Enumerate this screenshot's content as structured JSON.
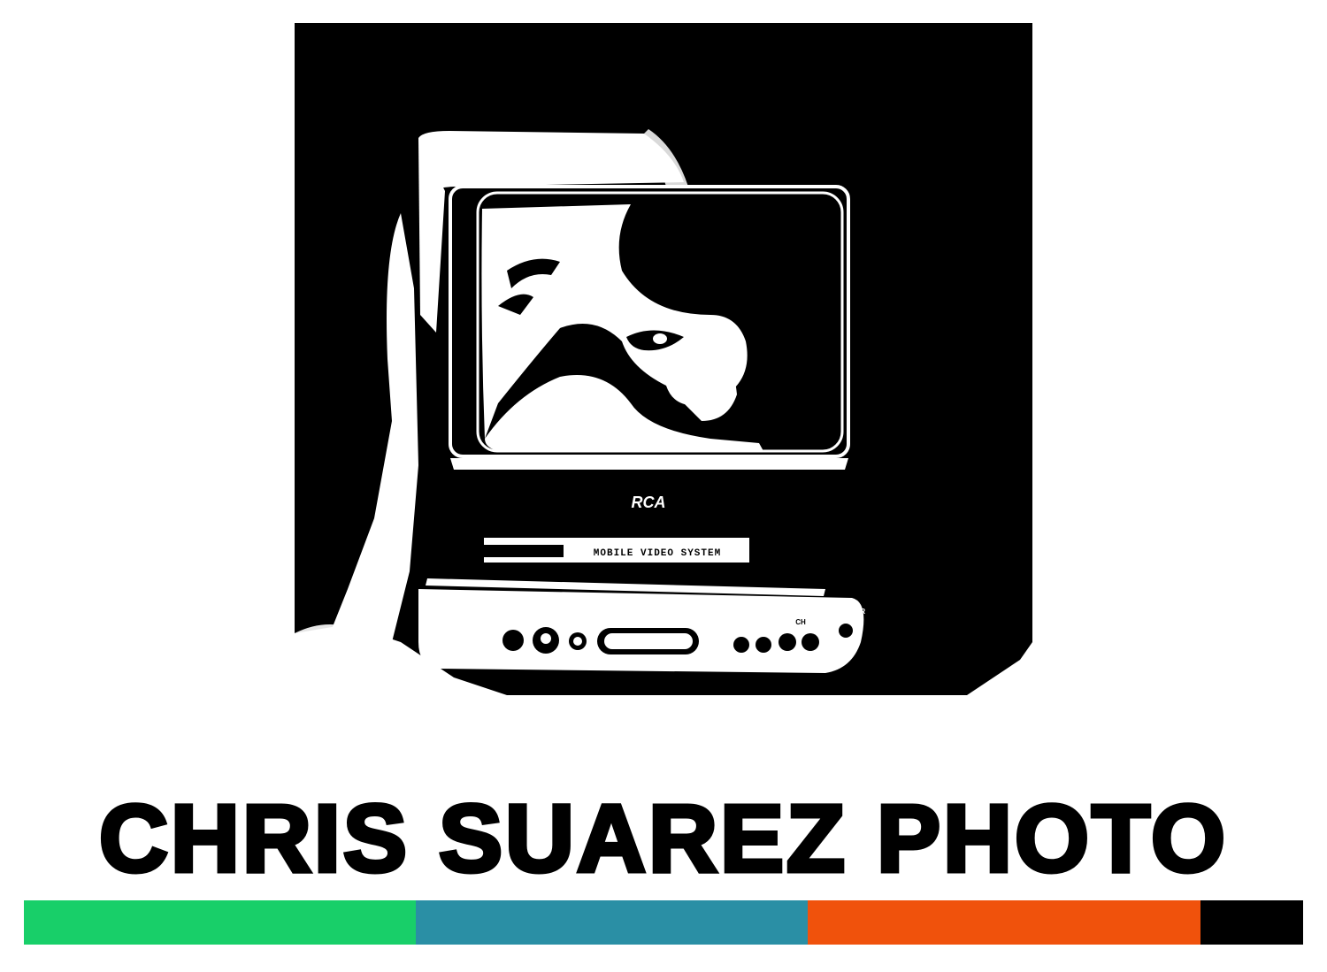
{
  "brand": {
    "title": "CHRIS SUAREZ PHOTO"
  },
  "photo": {
    "subject": "high-contrast black and white photo of a portable television",
    "tv_brand_label": "RCA",
    "tv_slot_label": "MOBILE VIDEO SYSTEM",
    "tv_power_label": "POWER",
    "tv_channel_label": "CH"
  },
  "color_bar": {
    "segments": [
      {
        "name": "green",
        "color": "#18cf69"
      },
      {
        "name": "teal",
        "color": "#2a8fa5"
      },
      {
        "name": "orange",
        "color": "#f0520c"
      },
      {
        "name": "black",
        "color": "#000000"
      }
    ]
  }
}
